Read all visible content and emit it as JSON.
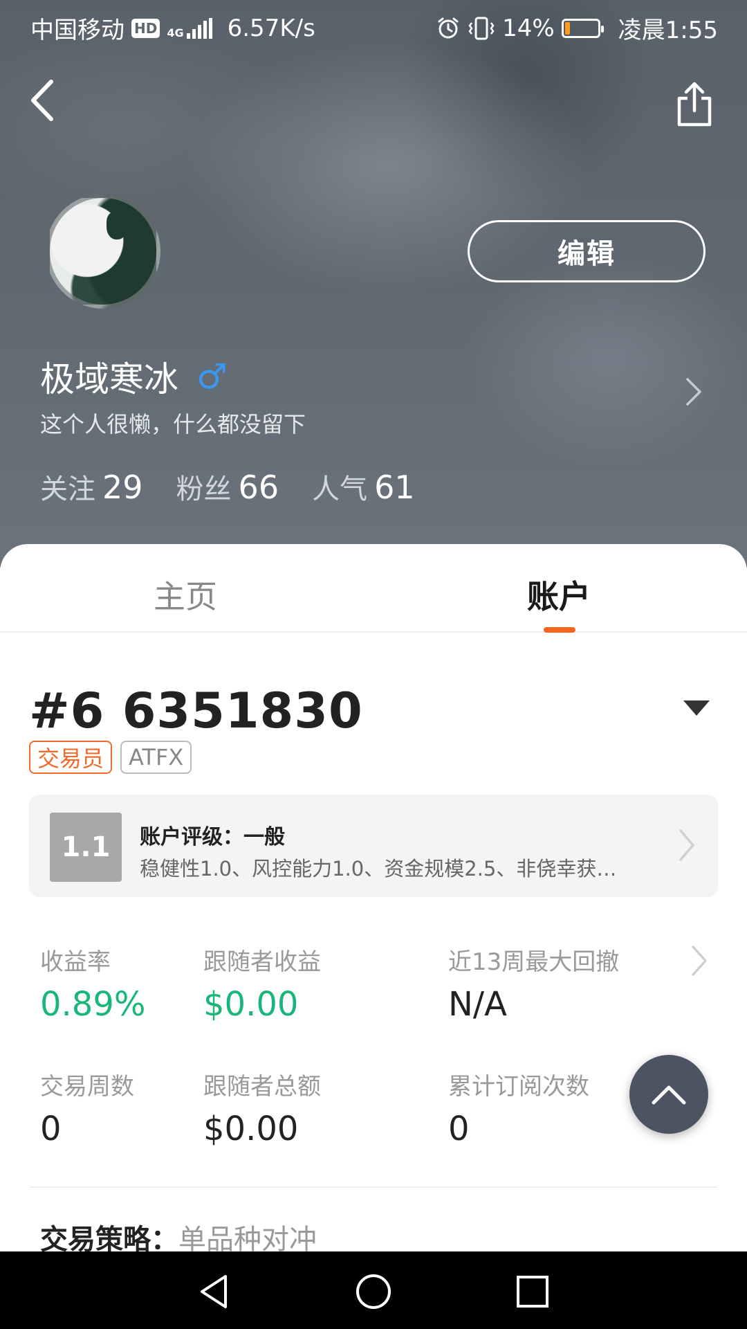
{
  "status_bar": {
    "carrier": "中国移动",
    "hd_badge": "HD",
    "network_type": "4G",
    "speed": "6.57K/s",
    "battery_percent": "14%",
    "battery_level": 0.14,
    "time": "凌晨1:55",
    "icons": [
      "alarm-icon",
      "vibrate-icon",
      "signal-icon",
      "battery-icon"
    ]
  },
  "header": {
    "back_icon": "chevron-left-icon",
    "share_icon": "share-icon",
    "edit_label": "编辑"
  },
  "profile": {
    "name": "极域寒冰",
    "gender_symbol": "♂",
    "bio": "这个人很懒，什么都没留下",
    "stats": [
      {
        "label": "关注",
        "value": "29"
      },
      {
        "label": "粉丝",
        "value": "66"
      },
      {
        "label": "人气",
        "value": "61"
      }
    ]
  },
  "tabs": [
    {
      "label": "主页",
      "active": false
    },
    {
      "label": "账户",
      "active": true
    }
  ],
  "account": {
    "number": "#6 6351830",
    "tags": [
      "交易员",
      "ATFX"
    ],
    "rating": {
      "score": "1.1",
      "title": "账户评级：一般",
      "detail": "稳健性1.0、风控能力1.0、资金规模2.5、非侥幸获…"
    },
    "metrics": [
      {
        "label": "收益率",
        "value": "0.89%",
        "highlight": true
      },
      {
        "label": "跟随者收益",
        "value": "$0.00",
        "highlight": true
      },
      {
        "label": "近13周最大回撤",
        "value": "N/A",
        "highlight": false
      },
      {
        "label": "交易周数",
        "value": "0",
        "highlight": false
      },
      {
        "label": "跟随者总额",
        "value": "$0.00",
        "highlight": false
      },
      {
        "label": "累计订阅次数",
        "value": "0",
        "highlight": false
      }
    ],
    "strategy": {
      "label": "交易策略：",
      "value": "单品种对冲"
    }
  },
  "colors": {
    "accent": "#f4651d",
    "positive": "#18b679",
    "gender": "#3b97f0",
    "fab": "#4c5363"
  },
  "nav_bar": [
    "back-triangle-icon",
    "home-circle-icon",
    "recents-square-icon"
  ]
}
